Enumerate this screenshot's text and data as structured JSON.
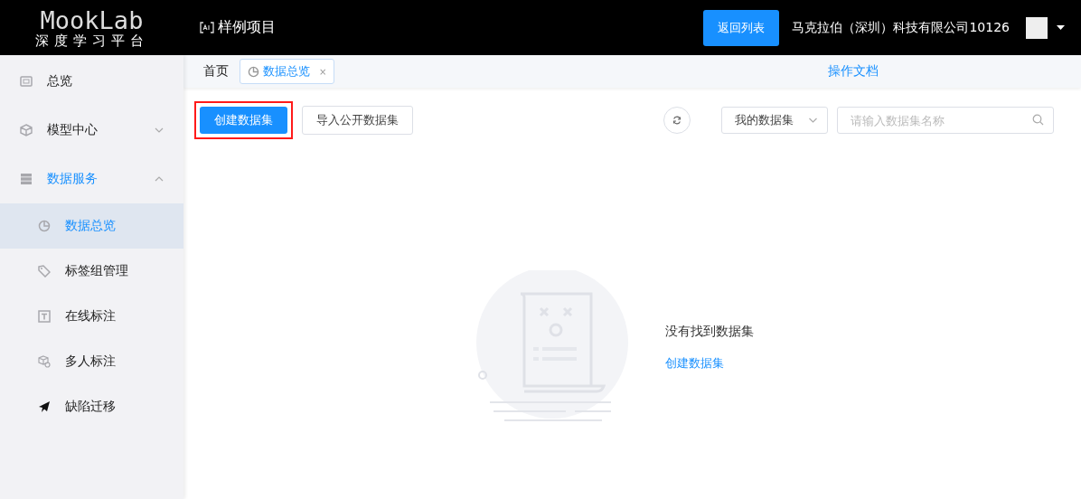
{
  "header": {
    "logo_title": "MookLab",
    "logo_subtitle": "深度学习平台",
    "project": "样例项目",
    "back_button": "返回列表",
    "company": "马克拉伯（深圳）科技有限公司10126"
  },
  "sidebar": {
    "items": [
      {
        "label": "总览",
        "selected": false
      },
      {
        "label": "模型中心",
        "selected": false,
        "expanded": false
      },
      {
        "label": "数据服务",
        "selected": false,
        "expanded": true,
        "children": [
          {
            "label": "数据总览",
            "selected": true
          },
          {
            "label": "标签组管理",
            "selected": false
          },
          {
            "label": "在线标注",
            "selected": false
          },
          {
            "label": "多人标注",
            "selected": false
          },
          {
            "label": "缺陷迁移",
            "selected": false
          }
        ]
      }
    ]
  },
  "tabs": {
    "home": "首页",
    "items": [
      {
        "label": "数据总览",
        "selected": true,
        "close": "×"
      }
    ],
    "docs_link": "操作文档"
  },
  "toolbar": {
    "create_button": {
      "label": "创建数据集",
      "highlighted": true
    },
    "import_button": "导入公开数据集",
    "filter": {
      "value": "我的数据集"
    },
    "search": {
      "placeholder": "请输入数据集名称"
    }
  },
  "empty_state": {
    "message": "没有找到数据集",
    "link": "创建数据集"
  }
}
